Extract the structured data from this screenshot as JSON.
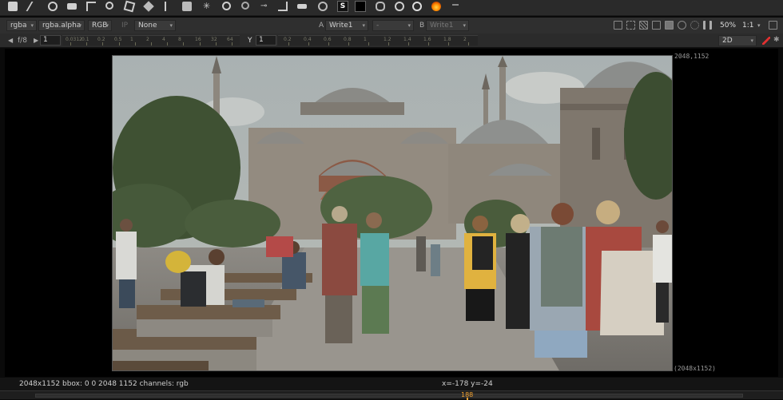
{
  "toolbar": {
    "icons": [
      "wipe-icon",
      "paint-icon",
      "circle-icon",
      "rect-icon",
      "crop-icon",
      "node-icon",
      "transform-icon",
      "cube-icon",
      "star-icon",
      "glasses-icon",
      "grade-icon",
      "keyer-icon",
      "merge-icon",
      "dots-icon",
      "roi-icon",
      "s-icon",
      "proxy-icon",
      "link-icon",
      "nuke-icon",
      "flame-icon",
      "cam-icon"
    ],
    "s_glyph": "S"
  },
  "viewer_controls": {
    "layer": "rgba",
    "alpha_channel": "rgba.alpha",
    "display_channels": "RGB",
    "ip_label": "IP",
    "lut": "None",
    "a_label": "A",
    "a_input": "Write1",
    "compare_op": "-",
    "b_label": "B",
    "b_input": "Write1",
    "zoom": "50%",
    "proxy_ratio": "1:1"
  },
  "viewer_row2": {
    "fstop": "f/8",
    "gain_value": "1",
    "gain_ticks": [
      "0.0312",
      "0.1",
      "0.2",
      "0.5",
      "1",
      "2",
      "4",
      "8",
      "16",
      "32",
      "64"
    ],
    "gamma_label": "Y",
    "gamma_value": "1",
    "gamma_ticks": [
      "0.2",
      "0.4",
      "0.6",
      "0.8",
      "1",
      "1.2",
      "1.4",
      "1.6",
      "1.8",
      "2"
    ],
    "view_mode": "2D"
  },
  "viewer": {
    "format_top": "2048,1152",
    "format_bottom": "(2048x1152)"
  },
  "status": {
    "info": "2048x1152  bbox: 0 0 2048 1152 channels: rgb",
    "coords": "x=-178 y=-24"
  },
  "timeline": {
    "current_frame": "188"
  },
  "colors": {
    "accent": "#f0a030",
    "sky": "#9aa5a8",
    "stone": "#8f8478"
  }
}
